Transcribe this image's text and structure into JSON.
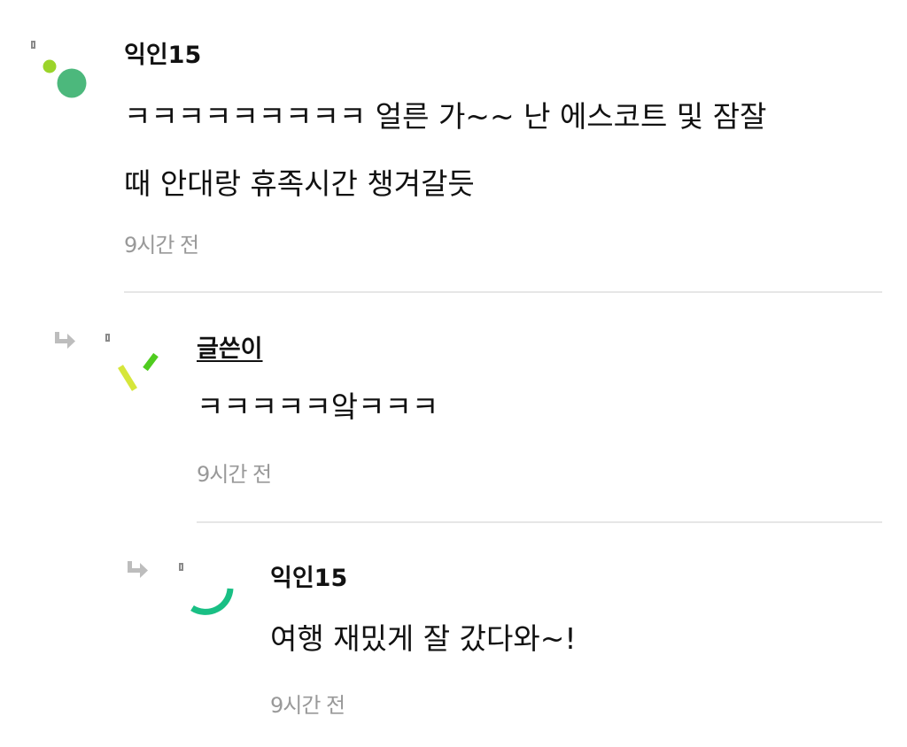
{
  "comments": [
    {
      "author": "익인15",
      "lines": [
        "ㅋㅋㅋㅋㅋㅋㅋㅋㅋ 얼른 가~~ 난 에스코트 및 잠잘",
        "때 안대랑 휴족시간 챙겨갈듯"
      ],
      "time": "9시간 전",
      "avatar": {
        "colors": [
          "#9bd42a",
          "#4cb87c"
        ]
      }
    },
    {
      "author": "글쓴이",
      "lines": [
        "ㅋㅋㅋㅋㅋ앜ㅋㅋㅋ"
      ],
      "time": "9시간 전",
      "is_reply": true,
      "avatar": {
        "colors": [
          "#d6e63a",
          "#4fcc1f"
        ]
      }
    },
    {
      "author": "익인15",
      "lines": [
        "여행 재밌게 잘 갔다와~!"
      ],
      "time": "9시간 전",
      "is_reply": true,
      "avatar": {
        "colors": [
          "#19bf84"
        ]
      }
    }
  ],
  "icons": {
    "reply_arrow": "reply-arrow-icon",
    "marker": "marker-icon"
  },
  "colors": {
    "text": "#111111",
    "muted": "#999999",
    "divider": "#e6e6e6",
    "icon_gray": "#bdbdbd"
  }
}
